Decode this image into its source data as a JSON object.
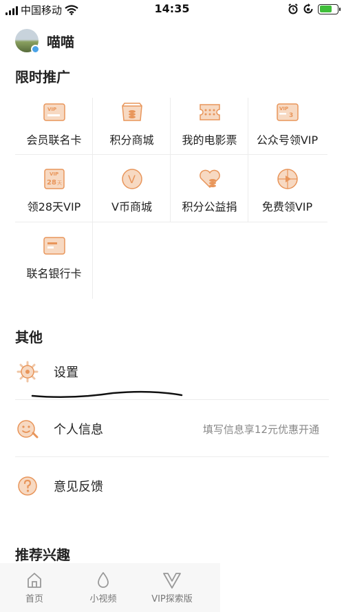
{
  "status_bar": {
    "carrier": "中国移动",
    "time": "14:35"
  },
  "profile": {
    "username": "喵喵"
  },
  "promo": {
    "title": "限时推广",
    "items": [
      {
        "label": "会员联名卡",
        "icon": "vip-card-icon"
      },
      {
        "label": "积分商城",
        "icon": "points-mall-icon"
      },
      {
        "label": "我的电影票",
        "icon": "movie-ticket-icon"
      },
      {
        "label": "公众号领VIP",
        "icon": "official-account-vip-icon"
      },
      {
        "label": "领28天VIP",
        "icon": "vip-28-days-icon"
      },
      {
        "label": "V币商城",
        "icon": "v-coin-mall-icon"
      },
      {
        "label": "积分公益捐",
        "icon": "charity-donation-icon"
      },
      {
        "label": "免费领VIP",
        "icon": "free-vip-icon"
      },
      {
        "label": "联名银行卡",
        "icon": "bank-card-icon"
      }
    ],
    "icon_texts": {
      "vip": "VIP",
      "days28": "28",
      "days_unit": "天",
      "v": "V",
      "num3": "3"
    }
  },
  "other": {
    "title": "其他",
    "items": [
      {
        "label": "设置",
        "icon": "gear-icon"
      },
      {
        "label": "个人信息",
        "icon": "face-icon",
        "trailing": "填写信息享12元优惠开通"
      },
      {
        "label": "意见反馈",
        "icon": "question-icon"
      }
    ]
  },
  "recommend": {
    "title": "推荐兴趣"
  },
  "tabbar": {
    "items": [
      {
        "label": "首页",
        "icon": "home-icon"
      },
      {
        "label": "小视频",
        "icon": "droplet-icon"
      },
      {
        "label": "VIP探索版",
        "icon": "vip-explore-icon"
      }
    ]
  },
  "colors": {
    "accent": "#e8955a",
    "accent_light": "#f7d9c2",
    "battery": "#3fbe3a"
  }
}
